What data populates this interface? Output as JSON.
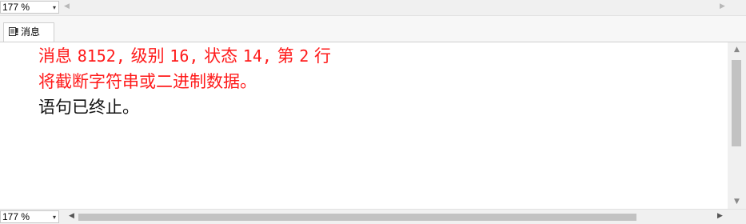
{
  "top_bar": {
    "zoom_value": "177 %",
    "dropdown_arrow": "▾",
    "scroll_left": "◀",
    "scroll_right": "▶"
  },
  "tab": {
    "label": "消息",
    "icon": "messages-icon"
  },
  "messages": {
    "line1_prefix": "消息",
    "line1_code": "8152,",
    "line1_level_label": "级别",
    "line1_level_value": "16,",
    "line1_state_label": "状态",
    "line1_state_value": "14,",
    "line1_row_label1": "第",
    "line1_row_value": "2",
    "line1_row_label2": "行",
    "line2": "将截断字符串或二进制数据。",
    "line3": "语句已终止。"
  },
  "bottom_bar": {
    "zoom_value": "177 %",
    "dropdown_arrow": "▾",
    "scroll_left": "◀",
    "scroll_right": "▶"
  },
  "vscroll": {
    "up": "▲",
    "down": "▼"
  },
  "colors": {
    "error_text": "#ff1a1a",
    "normal_text": "#111111"
  }
}
